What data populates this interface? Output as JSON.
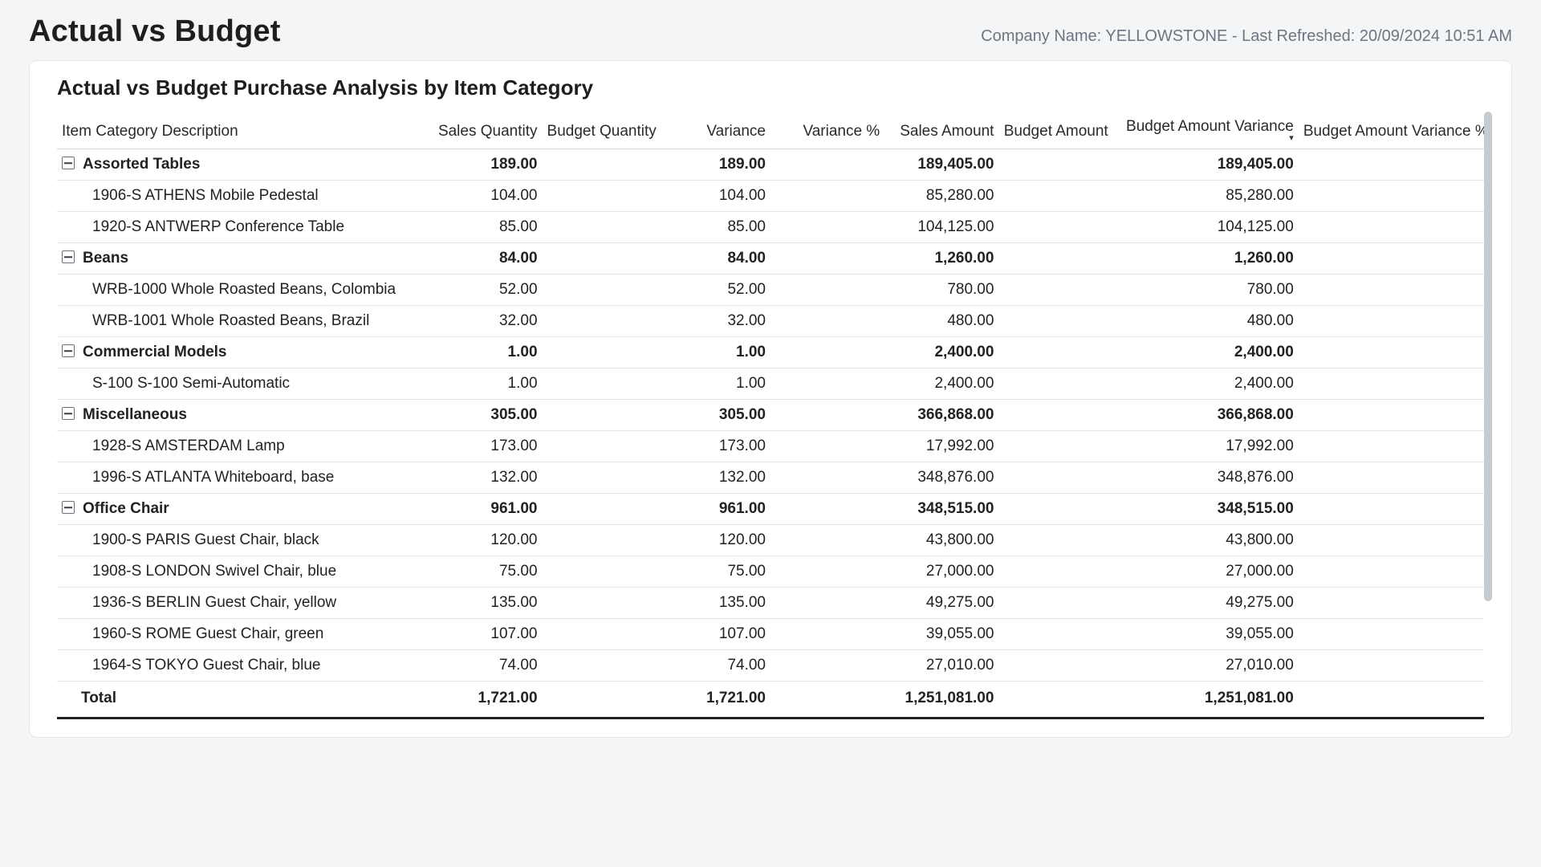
{
  "page": {
    "title": "Actual vs Budget",
    "meta_line": "Company Name: YELLOWSTONE - Last Refreshed: 20/09/2024 10:51 AM",
    "card_title": "Actual vs Budget Purchase Analysis by Item Category"
  },
  "columns": {
    "c0": "Item Category Description",
    "c1": "Sales Quantity",
    "c2": "Budget Quantity",
    "c3": "Variance",
    "c4": "Variance %",
    "c5": "Sales Amount",
    "c6": "Budget Amount",
    "c7": "Budget Amount Variance",
    "c8": "Budget Amount Variance %"
  },
  "rows": [
    {
      "type": "group",
      "label": "Assorted Tables",
      "sales_qty": "189.00",
      "variance": "189.00",
      "sales_amt": "189,405.00",
      "bav": "189,405.00"
    },
    {
      "type": "item",
      "label": "1906-S ATHENS Mobile Pedestal",
      "sales_qty": "104.00",
      "variance": "104.00",
      "sales_amt": "85,280.00",
      "bav": "85,280.00"
    },
    {
      "type": "item",
      "label": "1920-S ANTWERP Conference Table",
      "sales_qty": "85.00",
      "variance": "85.00",
      "sales_amt": "104,125.00",
      "bav": "104,125.00"
    },
    {
      "type": "group",
      "label": "Beans",
      "sales_qty": "84.00",
      "variance": "84.00",
      "sales_amt": "1,260.00",
      "bav": "1,260.00"
    },
    {
      "type": "item",
      "label": "WRB-1000 Whole Roasted Beans, Colombia",
      "sales_qty": "52.00",
      "variance": "52.00",
      "sales_amt": "780.00",
      "bav": "780.00"
    },
    {
      "type": "item",
      "label": "WRB-1001 Whole Roasted Beans, Brazil",
      "sales_qty": "32.00",
      "variance": "32.00",
      "sales_amt": "480.00",
      "bav": "480.00"
    },
    {
      "type": "group",
      "label": "Commercial Models",
      "sales_qty": "1.00",
      "variance": "1.00",
      "sales_amt": "2,400.00",
      "bav": "2,400.00"
    },
    {
      "type": "item",
      "label": "S-100 S-100 Semi-Automatic",
      "sales_qty": "1.00",
      "variance": "1.00",
      "sales_amt": "2,400.00",
      "bav": "2,400.00"
    },
    {
      "type": "group",
      "label": "Miscellaneous",
      "sales_qty": "305.00",
      "variance": "305.00",
      "sales_amt": "366,868.00",
      "bav": "366,868.00"
    },
    {
      "type": "item",
      "label": "1928-S AMSTERDAM Lamp",
      "sales_qty": "173.00",
      "variance": "173.00",
      "sales_amt": "17,992.00",
      "bav": "17,992.00"
    },
    {
      "type": "item",
      "label": "1996-S ATLANTA Whiteboard, base",
      "sales_qty": "132.00",
      "variance": "132.00",
      "sales_amt": "348,876.00",
      "bav": "348,876.00"
    },
    {
      "type": "group",
      "label": "Office Chair",
      "sales_qty": "961.00",
      "variance": "961.00",
      "sales_amt": "348,515.00",
      "bav": "348,515.00"
    },
    {
      "type": "item",
      "label": "1900-S PARIS Guest Chair, black",
      "sales_qty": "120.00",
      "variance": "120.00",
      "sales_amt": "43,800.00",
      "bav": "43,800.00"
    },
    {
      "type": "item",
      "label": "1908-S LONDON Swivel Chair, blue",
      "sales_qty": "75.00",
      "variance": "75.00",
      "sales_amt": "27,000.00",
      "bav": "27,000.00"
    },
    {
      "type": "item",
      "label": "1936-S BERLIN Guest Chair, yellow",
      "sales_qty": "135.00",
      "variance": "135.00",
      "sales_amt": "49,275.00",
      "bav": "49,275.00"
    },
    {
      "type": "item",
      "label": "1960-S ROME Guest Chair, green",
      "sales_qty": "107.00",
      "variance": "107.00",
      "sales_amt": "39,055.00",
      "bav": "39,055.00"
    },
    {
      "type": "item",
      "label": "1964-S TOKYO Guest Chair, blue",
      "sales_qty": "74.00",
      "variance": "74.00",
      "sales_amt": "27,010.00",
      "bav": "27,010.00"
    }
  ],
  "total": {
    "label": "Total",
    "sales_qty": "1,721.00",
    "variance": "1,721.00",
    "sales_amt": "1,251,081.00",
    "bav": "1,251,081.00"
  },
  "chart_data": {
    "type": "table",
    "title": "Actual vs Budget Purchase Analysis by Item Category",
    "columns": [
      "Item Category Description",
      "Sales Quantity",
      "Budget Quantity",
      "Variance",
      "Variance %",
      "Sales Amount",
      "Budget Amount",
      "Budget Amount Variance",
      "Budget Amount Variance %"
    ],
    "category_totals": [
      {
        "category": "Assorted Tables",
        "sales_qty": 189,
        "variance": 189,
        "sales_amount": 189405,
        "budget_amount_variance": 189405
      },
      {
        "category": "Beans",
        "sales_qty": 84,
        "variance": 84,
        "sales_amount": 1260,
        "budget_amount_variance": 1260
      },
      {
        "category": "Commercial Models",
        "sales_qty": 1,
        "variance": 1,
        "sales_amount": 2400,
        "budget_amount_variance": 2400
      },
      {
        "category": "Miscellaneous",
        "sales_qty": 305,
        "variance": 305,
        "sales_amount": 366868,
        "budget_amount_variance": 366868
      },
      {
        "category": "Office Chair",
        "sales_qty": 961,
        "variance": 961,
        "sales_amount": 348515,
        "budget_amount_variance": 348515
      }
    ],
    "grand_total": {
      "sales_qty": 1721,
      "variance": 1721,
      "sales_amount": 1251081,
      "budget_amount_variance": 1251081
    }
  }
}
